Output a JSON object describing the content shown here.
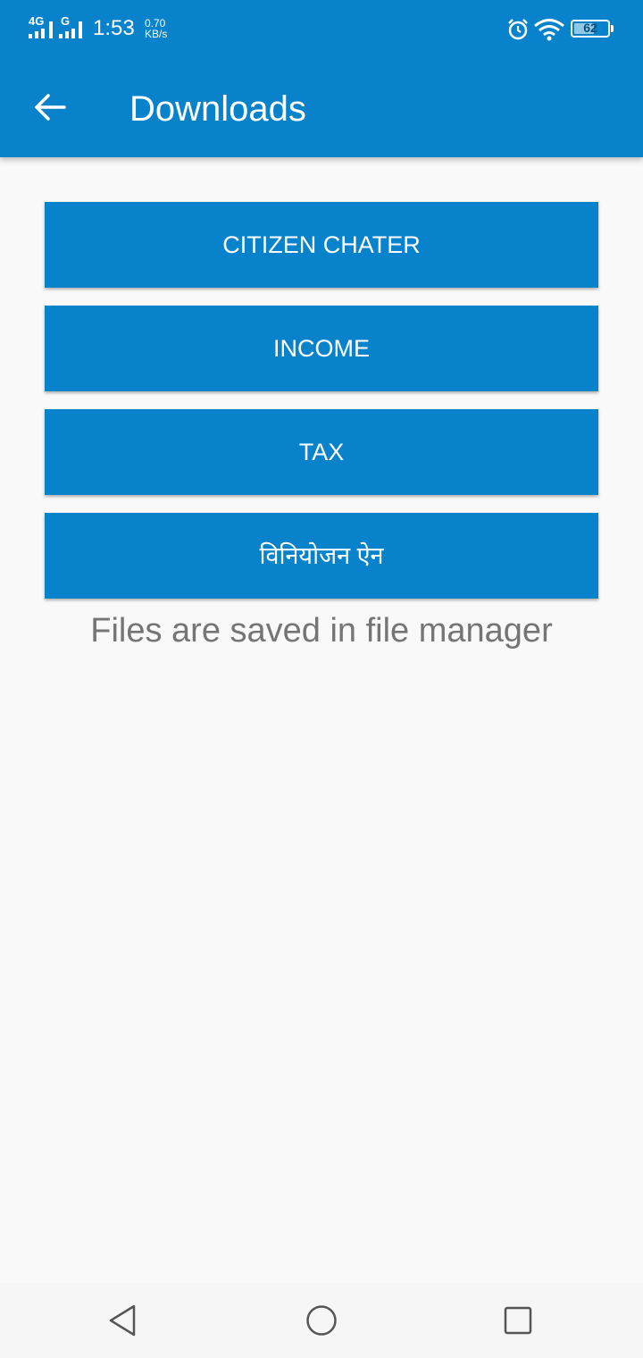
{
  "status_bar": {
    "network_1": "4G",
    "network_2": "G",
    "time": "1:53",
    "speed_value": "0.70",
    "speed_unit": "KB/s",
    "battery": "62",
    "battery_level": 0.62,
    "icons": [
      "signal-icon",
      "signal-icon",
      "alarm-icon",
      "wifi-icon",
      "battery-icon"
    ]
  },
  "toolbar": {
    "back_icon": "arrow-left-icon",
    "title": "Downloads"
  },
  "buttons": [
    {
      "label": "CITIZEN CHATER"
    },
    {
      "label": "INCOME"
    },
    {
      "label": "TAX"
    },
    {
      "label": "विनियोजन ऐन"
    }
  ],
  "note": "Files are saved in file manager",
  "navbar": {
    "icons": [
      "back-triangle-icon",
      "home-circle-icon",
      "recents-square-icon"
    ]
  },
  "colors": {
    "primary": "#0883cb",
    "background": "#f9f9f9",
    "note_text": "#757575"
  }
}
